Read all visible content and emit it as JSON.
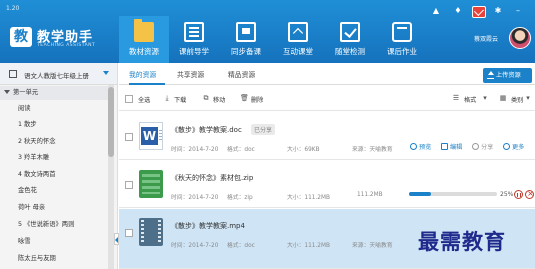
{
  "app": {
    "version": "1.20",
    "logo_letter": "教",
    "title": "教学助手",
    "subtitle": "TEACHING ASSISTANT",
    "accent_color": "#1b82c9",
    "header_color": "#1a7ec9"
  },
  "window_controls": [
    {
      "icon": "bell-icon",
      "glyph": "▲"
    },
    {
      "icon": "location-pin-icon",
      "glyph": "♦"
    },
    {
      "icon": "mail-icon",
      "glyph": ""
    },
    {
      "icon": "gear-icon",
      "glyph": "✱"
    },
    {
      "icon": "minimize-icon",
      "glyph": "–"
    }
  ],
  "nav": [
    {
      "label": "教材资源",
      "icon": "folder-icon",
      "active": true
    },
    {
      "label": "课前导学",
      "icon": "book-icon",
      "active": false
    },
    {
      "label": "同步备课",
      "icon": "monitor-icon",
      "active": false
    },
    {
      "label": "互动课堂",
      "icon": "board-icon",
      "active": false
    },
    {
      "label": "随堂检测",
      "icon": "check-icon",
      "active": false
    },
    {
      "label": "课后作业",
      "icon": "bag-icon",
      "active": false
    }
  ],
  "user": {
    "name": "蔡双霞云"
  },
  "sidebar": {
    "book": "语文人教版七年级上册",
    "tree": [
      {
        "label": "第一单元",
        "type": "unit"
      },
      {
        "label": "阅读",
        "type": "section"
      },
      {
        "label": "1   散步",
        "type": "lesson"
      },
      {
        "label": "2   秋天的怀念",
        "type": "lesson"
      },
      {
        "label": "3   羚羊木雕",
        "type": "lesson"
      },
      {
        "label": "4   散文诗两首",
        "type": "lesson"
      },
      {
        "label": "金色花",
        "type": "lesson"
      },
      {
        "label": "荷叶  母亲",
        "type": "lesson"
      },
      {
        "label": "5   《世说新语》两则",
        "type": "lesson"
      },
      {
        "label": "咏雪",
        "type": "lesson"
      },
      {
        "label": "陈太丘与友期",
        "type": "lesson"
      }
    ]
  },
  "tabs": [
    {
      "label": "我的资源",
      "active": true
    },
    {
      "label": "共享资源",
      "active": false
    },
    {
      "label": "精品资源",
      "active": false
    }
  ],
  "upload_label": "上传资源",
  "toolbar": {
    "select_all": "全选",
    "download": "下载",
    "move": "移动",
    "delete": "删除",
    "format": "格式",
    "category": "类别"
  },
  "files": [
    {
      "name": "《散步》教学教案.doc",
      "badge": "已分享",
      "time": "时间：2014-7-20",
      "format": "格式：doc",
      "size": "大小：69KB",
      "source": "来源：天喻教育",
      "icon": "word-file-icon",
      "actions": [
        "预览",
        "编辑",
        "分享",
        "更多"
      ]
    },
    {
      "name": "《秋天的怀念》素材包.zip",
      "time": "时间：2014-7-20",
      "format": "格式：zip",
      "size": "大小：111.2MB",
      "speed": "111.2MB",
      "progress": 0.25,
      "progress_text": "25%",
      "icon": "zip-file-icon"
    },
    {
      "name": "《散步》教学教案.mp4",
      "time": "时间：2014-7-20",
      "format": "格式：doc",
      "size": "大小：111.2MB",
      "source": "来源：天喻教育",
      "icon": "video-file-icon",
      "selected": true
    }
  ],
  "watermark": "最需教育"
}
